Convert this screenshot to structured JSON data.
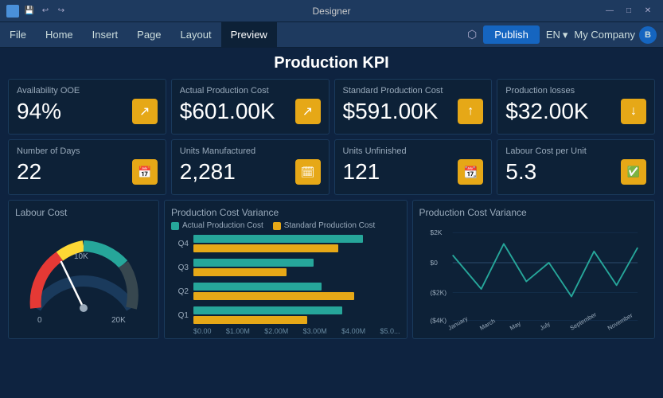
{
  "titlebar": {
    "app_name": "Designer",
    "minimize": "—",
    "maximize": "□",
    "close": "✕"
  },
  "menubar": {
    "items": [
      "File",
      "Home",
      "Insert",
      "Page",
      "Layout",
      "Preview"
    ],
    "active_index": 5,
    "right": {
      "publish_label": "Publish",
      "lang": "EN",
      "company": "My Company",
      "avatar_initials": "B"
    }
  },
  "page": {
    "title": "Production KPI"
  },
  "kpi_row1": [
    {
      "label": "Availability OOE",
      "value": "94%",
      "icon_type": "up-arrow",
      "icon_color": "gold"
    },
    {
      "label": "Actual Production Cost",
      "value": "$601.00K",
      "icon_type": "up-arrow",
      "icon_color": "gold"
    },
    {
      "label": "Standard Production Cost",
      "value": "$591.00K",
      "icon_type": "up-solid",
      "icon_color": "gold"
    },
    {
      "label": "Production losses",
      "value": "$32.00K",
      "icon_type": "down-solid",
      "icon_color": "gold"
    }
  ],
  "kpi_row2": [
    {
      "label": "Number of Days",
      "value": "22",
      "icon_type": "calendar",
      "icon_color": "gold"
    },
    {
      "label": "Units Manufactured",
      "value": "2,281",
      "icon_type": "cal-plus",
      "icon_color": "gold"
    },
    {
      "label": "Units Unfinished",
      "value": "121",
      "icon_type": "cal-minus",
      "icon_color": "gold"
    },
    {
      "label": "Labour Cost per Unit",
      "value": "5.3",
      "icon_type": "cal-check",
      "icon_color": "gold"
    }
  ],
  "charts": {
    "labour_cost": {
      "title": "Labour Cost",
      "min_label": "0",
      "max_label": "20K",
      "mid_label": "10K"
    },
    "production_cost_variance_bar": {
      "title": "Production Cost Variance",
      "legend": [
        {
          "label": "Actual Production Cost",
          "color": "#26a69a"
        },
        {
          "label": "Standard Production Cost",
          "color": "#e6a817"
        }
      ],
      "quarters": [
        "Q4",
        "Q3",
        "Q2",
        "Q1"
      ],
      "actual_widths": [
        82,
        58,
        62,
        72
      ],
      "standard_widths": [
        70,
        45,
        78,
        55
      ],
      "axis_labels": [
        "$0.00",
        "$1.00M",
        "$2.00M",
        "$3.00M",
        "$4.00M",
        "$5.0..."
      ]
    },
    "production_cost_variance_line": {
      "title": "Production Cost Variance",
      "y_labels": [
        "$2K",
        "$0",
        "($2K)",
        "($4K)"
      ],
      "x_labels": [
        "January",
        "March",
        "May",
        "July",
        "September",
        "November"
      ]
    }
  }
}
